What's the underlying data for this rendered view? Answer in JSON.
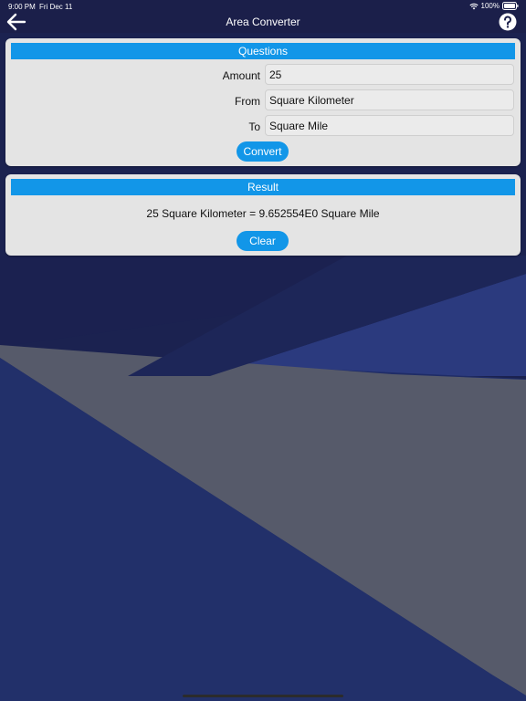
{
  "status_bar": {
    "time": "9:00 PM",
    "date": "Fri Dec 11",
    "battery": "100%"
  },
  "nav": {
    "title": "Area Converter",
    "back_icon": "arrow-left-icon",
    "help_icon": "question-circle-icon"
  },
  "questions": {
    "header": "Questions",
    "amount_label": "Amount",
    "amount_value": "25",
    "from_label": "From",
    "from_value": "Square Kilometer",
    "to_label": "To",
    "to_value": "Square Mile",
    "convert_label": "Convert"
  },
  "result": {
    "header": "Result",
    "text": "25 Square Kilometer = 9.652554E0 Square Mile",
    "clear_label": "Clear"
  },
  "colors": {
    "accent": "#1296e8",
    "panel": "#e4e4e4",
    "nav_bar": "#1b1f4a",
    "background": "#1e2a5c"
  }
}
